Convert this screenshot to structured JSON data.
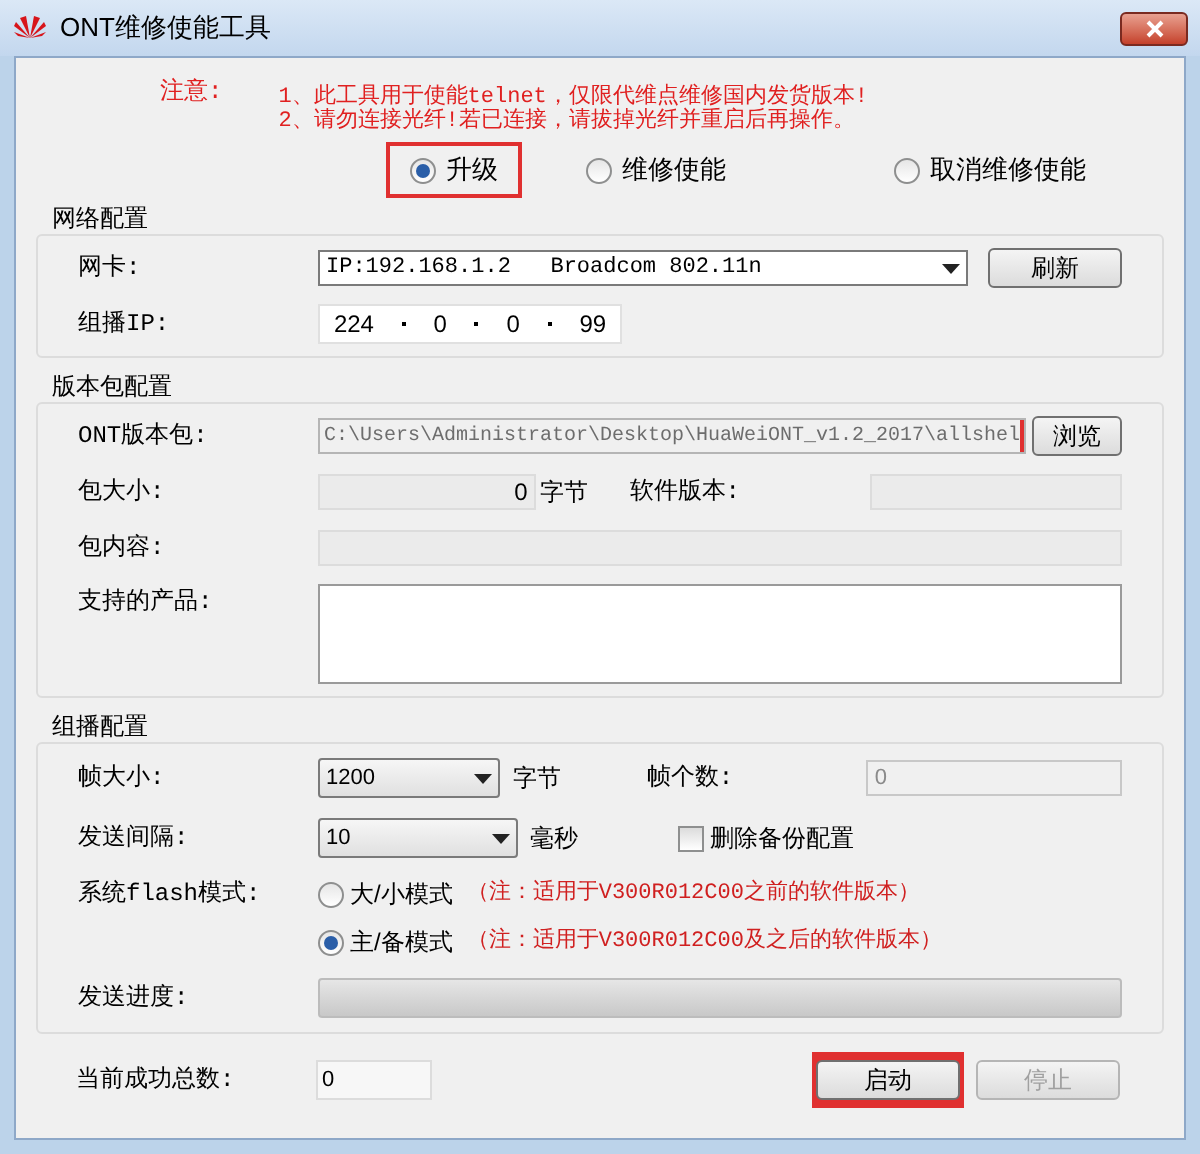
{
  "window": {
    "title": "ONT维修使能工具"
  },
  "notice": {
    "label": "注意:",
    "lines": [
      "1、此工具用于使能telnet，仅限代维点维修国内发货版本!",
      "2、请勿连接光纤!若已连接，请拔掉光纤并重启后再操作。"
    ]
  },
  "modes": [
    {
      "label": "升级",
      "selected": true,
      "highlighted": true
    },
    {
      "label": "维修使能",
      "selected": false,
      "highlighted": false
    },
    {
      "label": "取消维修使能",
      "selected": false,
      "highlighted": false
    }
  ],
  "network": {
    "title": "网络配置",
    "nic_label": "网卡:",
    "nic_value": "IP:192.168.1.2   Broadcom 802.11n",
    "refresh": "刷新",
    "ip_label": "组播IP:",
    "ip_parts": [
      "224",
      "0",
      "0",
      "99"
    ]
  },
  "package": {
    "title": "版本包配置",
    "file_label": "ONT版本包:",
    "file_value": "C:\\Users\\Administrator\\Desktop\\HuaWeiONT_v1.2_2017\\allshel",
    "file_highlighted": true,
    "browse": "浏览",
    "size_label": "包大小:",
    "size_value": "0",
    "size_unit": "字节",
    "version_label": "软件版本:",
    "content_label": "包内容:",
    "products_label": "支持的产品:"
  },
  "multicast": {
    "title": "组播配置",
    "frame_size_label": "帧大小:",
    "frame_size_value": "1200",
    "frame_size_unit": "字节",
    "frame_count_label": "帧个数:",
    "frame_count_value": "0",
    "interval_label": "发送间隔:",
    "interval_value": "10",
    "interval_unit": "毫秒",
    "delete_backup": {
      "label": "删除备份配置",
      "checked": false
    },
    "flash_label": "系统flash模式:",
    "flash_modes": [
      {
        "label": "大/小模式",
        "note": "（注：适用于V300R012C00之前的软件版本）",
        "selected": false
      },
      {
        "label": "主/备模式",
        "note": "（注：适用于V300R012C00及之后的软件版本）",
        "selected": true
      }
    ],
    "progress_label": "发送进度:",
    "progress": {
      "level": 0
    }
  },
  "footer": {
    "success_label": "当前成功总数:",
    "success_value": "0",
    "buttons": [
      {
        "label": "启动",
        "disabled": false,
        "highlighted": true
      },
      {
        "label": "停止",
        "disabled": true,
        "highlighted": false
      }
    ]
  }
}
